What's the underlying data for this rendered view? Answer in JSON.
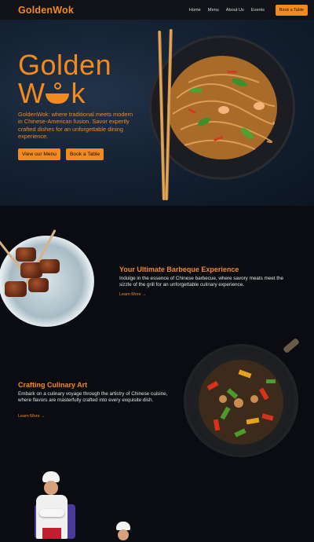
{
  "nav": {
    "logo": "GoldenWok",
    "links": [
      "Home",
      "Menu",
      "About Us",
      "Events"
    ],
    "cta": "Book a Table"
  },
  "hero": {
    "title_line1": "Golden",
    "title_line2_a": "W",
    "title_line2_b": "k",
    "tagline": "GoldenWok: where traditional meets modern in Chinese-American fusion. Savor expertly crafted dishes for an unforgettable dining experience.",
    "btn_menu": "View our Menu",
    "btn_book": "Book a Table"
  },
  "section1": {
    "title": "Your Ultimate Barbeque Experience",
    "text": "Indulge in the essence of Chinese barbecue, where savory meats meet the sizzle of the grill for an unforgettable culinary experience.",
    "link": "Learn More →"
  },
  "section2": {
    "title": "Crafting Culinary Art",
    "text": "Embark on a culinary voyage through the artistry of Chinese cuisine, where flavors are masterfully crafted into every exquisite dish.",
    "link": "Learn More →"
  },
  "colors": {
    "accent": "#f28a1e",
    "background": "#0a0c12",
    "hero_bg": "#152233"
  }
}
